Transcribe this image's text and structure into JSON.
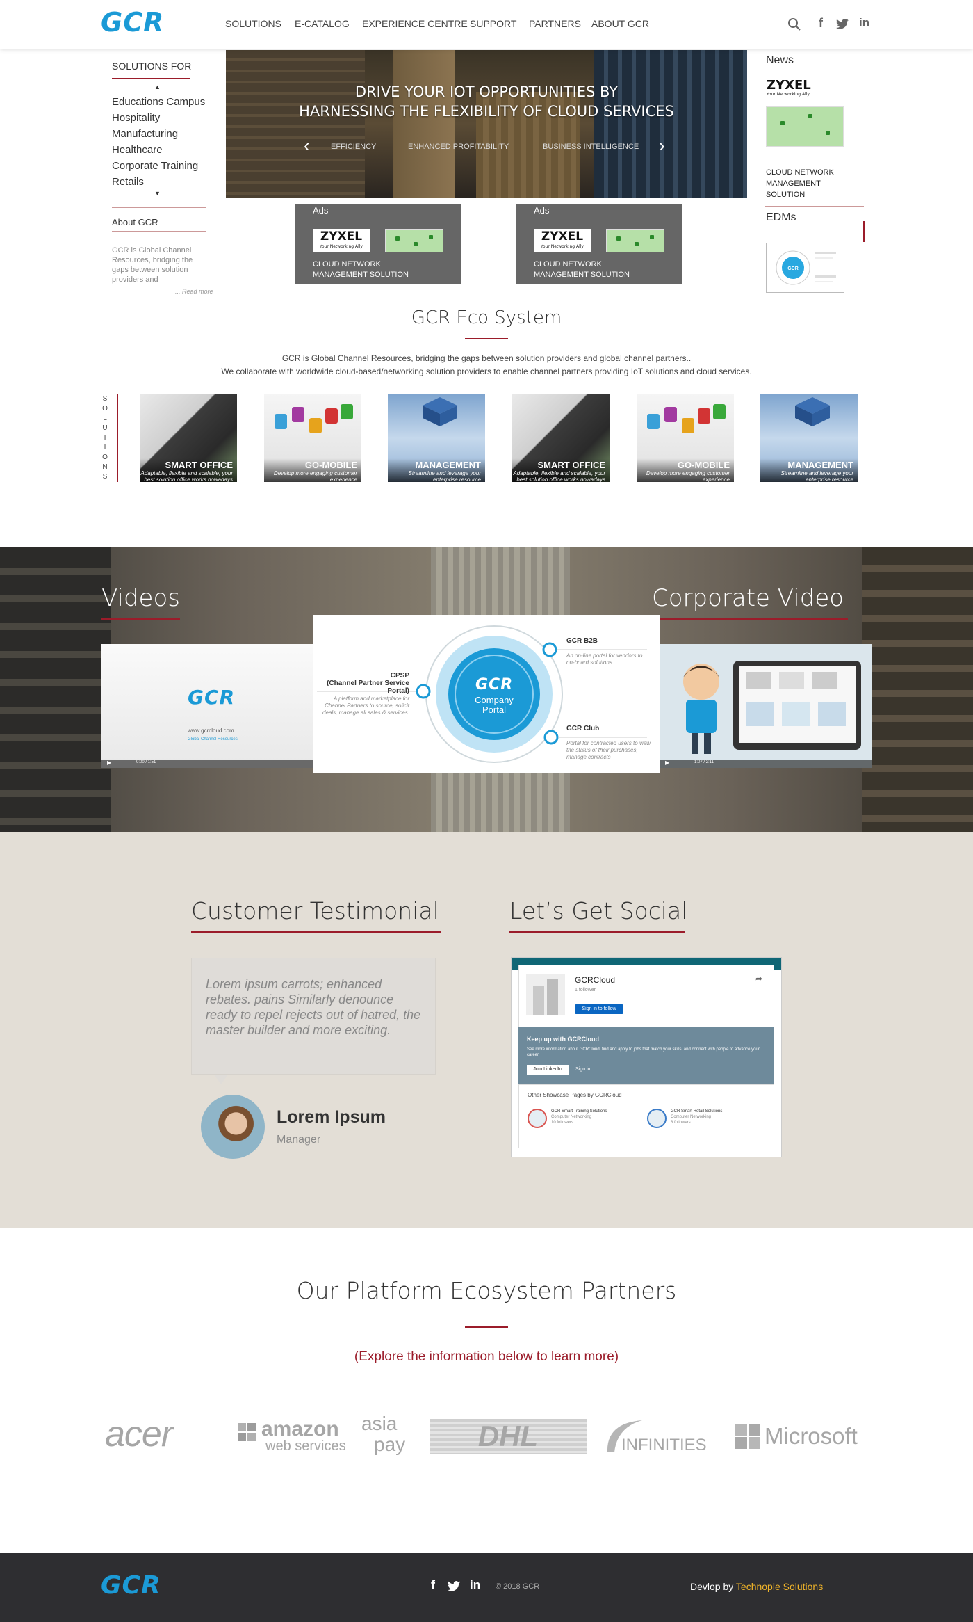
{
  "header": {
    "logo": "GCR",
    "nav": [
      "SOLUTIONS",
      "E-CATALOG",
      "EXPERIENCE CENTRE",
      "SUPPORT",
      "PARTNERS",
      "ABOUT GCR"
    ],
    "icons": [
      "search-icon",
      "facebook-icon",
      "twitter-icon",
      "linkedin-icon"
    ]
  },
  "sidebar": {
    "solutions_heading": "SOLUTIONS FOR",
    "solutions": [
      "Educations Campus",
      "Hospitality",
      "Manufacturing",
      "Healthcare",
      "Corporate Training",
      "Retails"
    ],
    "about_heading": "About GCR",
    "about_text": "GCR is Global Channel Resources, bridging the gaps between solution providers and",
    "read_more": "... Read more"
  },
  "hero": {
    "title_line1": "DRIVE YOUR IOT OPPORTUNITIES BY",
    "title_line2": "HARNESSING THE FLEXIBILITY OF CLOUD SERVICES",
    "tabs": [
      "EFFICIENCY",
      "ENHANCED PROFITABILITY",
      "BUSINESS INTELLIGENCE"
    ]
  },
  "ads": {
    "label": "Ads",
    "brand": "ZYXEL",
    "brand_tagline": "Your Networking Ally",
    "caption_line1": "CLOUD NETWORK",
    "caption_line2": "MANAGEMENT SOLUTION"
  },
  "news": {
    "heading": "News",
    "brand": "ZYXEL",
    "brand_tagline": "Your Networking Ally",
    "caption": "CLOUD NETWORK MANAGEMENT SOLUTION",
    "edms_heading": "EDMs"
  },
  "eco": {
    "title": "GCR Eco System",
    "line1": "GCR is Global Channel Resources, bridging the gaps between solution providers and global channel partners..",
    "line2": "We collaborate with worldwide cloud-based/networking solution providers to enable channel partners providing IoT solutions and cloud services.",
    "vertical_label": "SOLUTIONS",
    "tiles": [
      {
        "title": "SMART OFFICE",
        "sub": "Adaptable, flexible and scalable, your best solution office works nowadays"
      },
      {
        "title": "GO-MOBILE",
        "sub": "Develop more engaging customer experience"
      },
      {
        "title": "MANAGEMENT",
        "sub": "Streamline and leverage your enterprise resource"
      },
      {
        "title": "SMART OFFICE",
        "sub": "Adaptable, flexible and scalable, your best solution office works nowadays"
      },
      {
        "title": "GO-MOBILE",
        "sub": "Develop more engaging customer experience"
      },
      {
        "title": "MANAGEMENT",
        "sub": "Streamline and leverage your enterprise resource"
      }
    ]
  },
  "videos": {
    "left_title": "Videos",
    "right_title": "Corporate Video",
    "left_logo": "GCR",
    "left_url": "www.gcrcloud.com",
    "left_tagline": "Global Channel Resources",
    "left_time": "0:00 / 1:51",
    "right_time": "1:07 / 2:11",
    "portal": {
      "center_logo": "GCR",
      "center_line1": "Company",
      "center_line2": "Portal",
      "cpsp_title": "CPSP",
      "cpsp_sub": "(Channel Partner Service Portal)",
      "cpsp_desc": "A platform and marketplace for Channel Partners to source, solicit deals, manage all sales & services.",
      "b2b_title": "GCR B2B",
      "b2b_desc": "An on-line portal for vendors to on-board solutions",
      "club_title": "GCR Club",
      "club_desc": "Portal for contracted users to view the status of their purchases, manage contracts"
    }
  },
  "testimonial": {
    "heading": "Customer Testimonial",
    "quote": "Lorem ipsum carrots; enhanced rebates. pains Similarly denounce ready to repel rejects out of hatred, the master builder and more exciting.",
    "name": "Lorem Ipsum",
    "role": "Manager"
  },
  "social": {
    "heading": "Let’s Get Social",
    "company": "GCRCloud",
    "followers": "1 follower",
    "follow_btn": "Sign in to follow",
    "keep_title": "Keep up with GCRCloud",
    "keep_text": "See more information about GCRCloud, find and apply to jobs that match your skills, and connect with people to advance your career.",
    "join_btn": "Join LinkedIn",
    "signin": "Sign in",
    "showcase_heading": "Other Showcase Pages by GCRCloud",
    "showcase": [
      {
        "name": "GCR Smart Training Solutions",
        "industry": "Computer Networking",
        "followers": "10 followers"
      },
      {
        "name": "GCR Smart Retail Solutions",
        "industry": "Computer Networking",
        "followers": "8 followers"
      }
    ]
  },
  "partners": {
    "title": "Our Platform Ecosystem Partners",
    "subtitle": "(Explore the information below to learn more)",
    "logos": [
      "acer",
      "amazon",
      "web services",
      "asia",
      "pay",
      "DHL",
      "INFINITIES",
      "Microsoft"
    ]
  },
  "footer": {
    "logo": "GCR",
    "copyright": "© 2018 GCR",
    "devlop": "Devlop by",
    "developer": "Technople Solutions"
  },
  "colors": {
    "brand_blue": "#1b9ad6",
    "accent_red": "#9b1c2a",
    "footer_bg": "#2e2e31",
    "dev_link": "#f0b429"
  }
}
